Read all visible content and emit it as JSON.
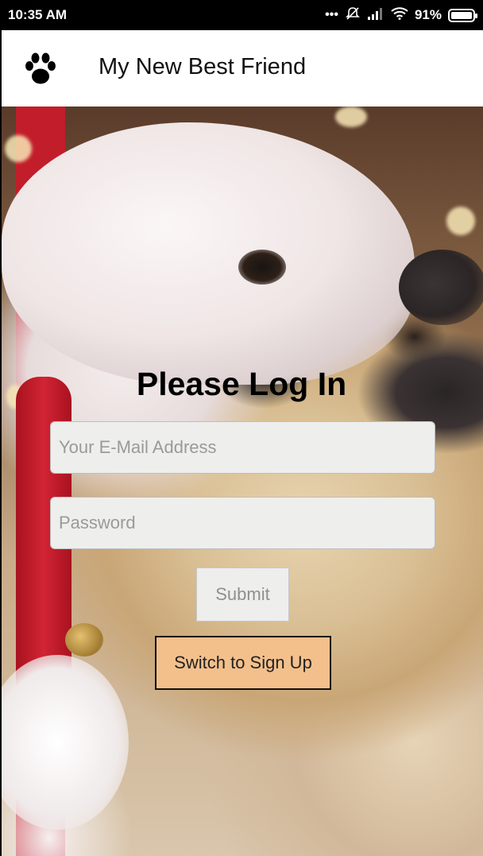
{
  "status_bar": {
    "time": "10:35 AM",
    "dots": "•••",
    "battery_percent": "91%",
    "icons": [
      "notifications-muted-icon",
      "signal-icon",
      "wifi-icon",
      "battery-icon"
    ]
  },
  "app_bar": {
    "title": "My New Best Friend",
    "logo_icon": "paw-icon"
  },
  "login": {
    "heading": "Please Log In",
    "email_placeholder": "Your E-Mail Address",
    "email_value": "",
    "password_placeholder": "Password",
    "password_value": "",
    "submit_label": "Submit",
    "switch_label": "Switch to Sign Up"
  },
  "colors": {
    "switch_button_bg": "#f3c08c",
    "field_bg": "#eeeeec",
    "status_bar_bg": "#000000",
    "app_bar_bg": "#ffffff"
  }
}
